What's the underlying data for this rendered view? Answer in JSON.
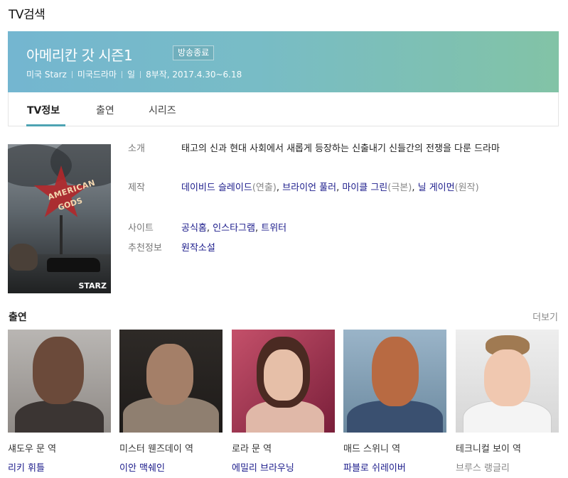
{
  "page_title": "TV검색",
  "show": {
    "title": "아메리칸 갓 시즌1",
    "status_badge": "방송종료",
    "meta": [
      "미국 Starz",
      "미국드라마",
      "일",
      "8부작, 2017.4.30~6.18"
    ]
  },
  "tabs": [
    {
      "label": "TV정보",
      "active": true
    },
    {
      "label": "출연",
      "active": false
    },
    {
      "label": "시리즈",
      "active": false
    }
  ],
  "poster": {
    "title_line1": "AMERICAN",
    "title_line2": "GODS",
    "network": "STARZ"
  },
  "info": {
    "intro_label": "소개",
    "intro_text": "태고의 신과 현대 사회에서 새롭게 등장하는 신출내기 신들간의 전쟁을 다룬 드라마",
    "production_label": "제작",
    "production": {
      "p1": "데이비드 슬레이드",
      "r1": "(연출)",
      "p2": "브라이언 풀러",
      "p3": "마이클 그린",
      "r3": "(극본)",
      "p4": "닐 게이먼",
      "r4": "(원작)",
      "sep": ", "
    },
    "site_label": "사이트",
    "sites": [
      "공식홈",
      "인스타그램",
      "트위터"
    ],
    "recommend_label": "추천정보",
    "recommend": "원작소설"
  },
  "cast_section": {
    "title": "출연",
    "more": "더보기",
    "members": [
      {
        "role": "섀도우 문 역",
        "name": "리키 휘틀"
      },
      {
        "role": "미스터 웬즈데이 역",
        "name": "이안 맥쉐인"
      },
      {
        "role": "로라 문 역",
        "name": "에밀리 브라우닝"
      },
      {
        "role": "매드 스위니 역",
        "name": "파블로 쉬레이버"
      },
      {
        "role": "테크니컬 보이 역",
        "name": "브루스 랭글리"
      }
    ]
  },
  "colors": {
    "banner_start": "#74b6d0",
    "banner_end": "#82c3a6",
    "tab_accent": "#4ea3b3",
    "link": "#1a1a8a"
  }
}
